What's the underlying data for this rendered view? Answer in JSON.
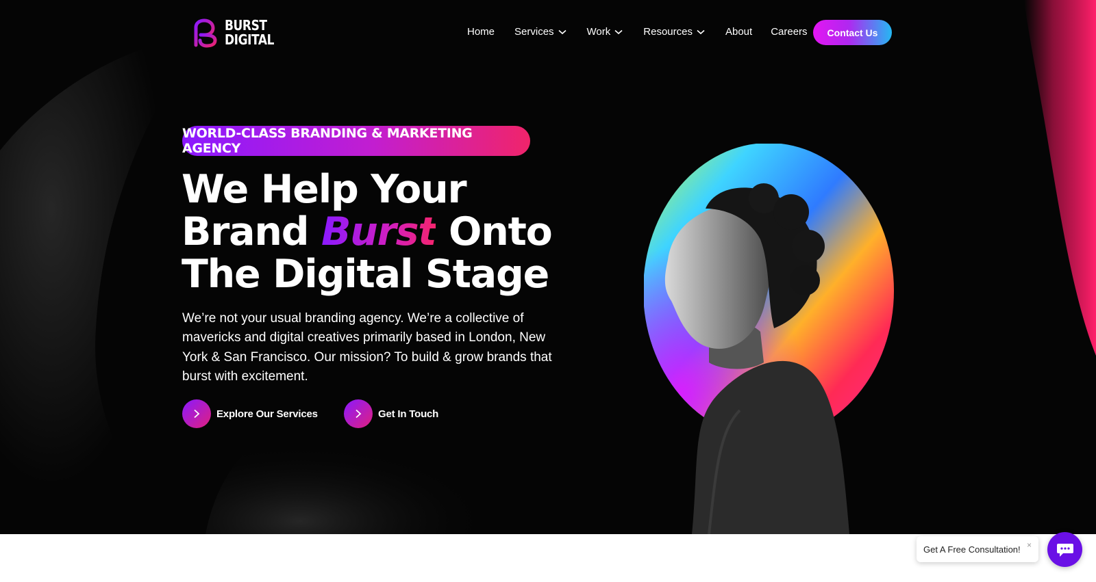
{
  "brand": {
    "name_line1": "BURST",
    "name_line2": "DIGITAL"
  },
  "nav": {
    "items": [
      {
        "label": "Home",
        "dropdown": false
      },
      {
        "label": "Services",
        "dropdown": true
      },
      {
        "label": "Work",
        "dropdown": true
      },
      {
        "label": "Resources",
        "dropdown": true
      },
      {
        "label": "About",
        "dropdown": false
      },
      {
        "label": "Careers",
        "dropdown": false
      }
    ],
    "contact_label": "Contact Us"
  },
  "hero": {
    "badge": "WORLD-CLASS BRANDING & MARKETING AGENCY",
    "headline_line1": "We Help Your",
    "headline_line2_pre": "Brand ",
    "headline_highlight": "Burst",
    "headline_line2_post": " Onto",
    "headline_line3": "The Digital Stage",
    "description": "We’re not your usual branding agency. We’re a collective of mavericks and digital creatives primarily based in London, New York & San Francisco. Our mission? To build & grow brands that burst with excitement.",
    "cta_primary": "Explore Our Services",
    "cta_secondary": "Get In Touch"
  },
  "widget": {
    "consult_text": "Get A Free Consultation!",
    "close_glyph": "×"
  },
  "icons": {
    "logo": "burst-logo-icon",
    "chevron": "chevron-down-icon",
    "cta_arrow": "chevron-right-icon",
    "chat": "chat-bubble-icon"
  },
  "colors": {
    "background": "#050505",
    "accent_purple": "#8b19ff",
    "accent_pink": "#f0246a",
    "accent_cyan": "#24b8f2",
    "chat_button": "#6a10e6"
  }
}
